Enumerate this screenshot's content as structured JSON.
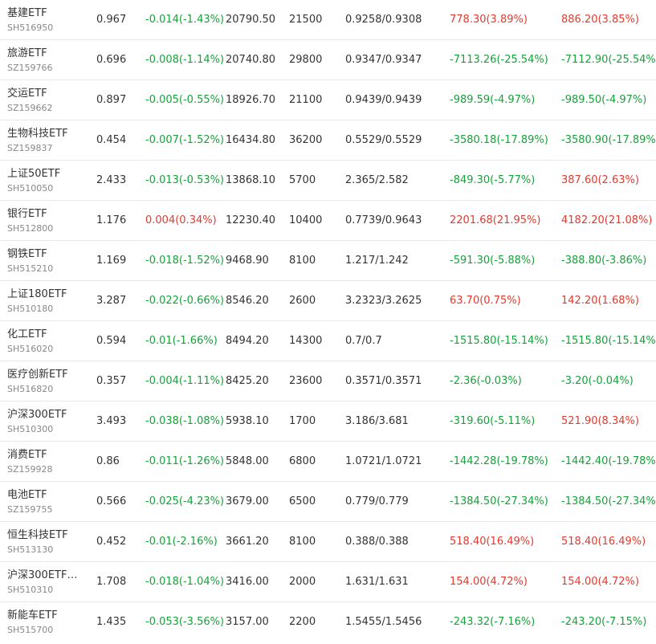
{
  "colors": {
    "up": "#e23a2e",
    "down": "#18a03b",
    "text": "#333333",
    "subtext": "#888888",
    "divider": "#e8e8e8"
  },
  "rows": [
    {
      "name": "基建ETF",
      "code": "SH516950",
      "price": "0.967",
      "change": "-0.014(-1.43%)",
      "change_dir": "down",
      "value": "20790.50",
      "shares": "21500",
      "cost": "0.9258/0.9308",
      "day_pl": "778.30(3.89%)",
      "day_pl_dir": "up",
      "total_pl": "886.20(3.85%)",
      "total_pl_dir": "up"
    },
    {
      "name": "旅游ETF",
      "code": "SZ159766",
      "price": "0.696",
      "change": "-0.008(-1.14%)",
      "change_dir": "down",
      "value": "20740.80",
      "shares": "29800",
      "cost": "0.9347/0.9347",
      "day_pl": "-7113.26(-25.54%)",
      "day_pl_dir": "down",
      "total_pl": "-7112.90(-25.54%)",
      "total_pl_dir": "down"
    },
    {
      "name": "交运ETF",
      "code": "SZ159662",
      "price": "0.897",
      "change": "-0.005(-0.55%)",
      "change_dir": "down",
      "value": "18926.70",
      "shares": "21100",
      "cost": "0.9439/0.9439",
      "day_pl": "-989.59(-4.97%)",
      "day_pl_dir": "down",
      "total_pl": "-989.50(-4.97%)",
      "total_pl_dir": "down"
    },
    {
      "name": "生物科技ETF",
      "code": "SZ159837",
      "price": "0.454",
      "change": "-0.007(-1.52%)",
      "change_dir": "down",
      "value": "16434.80",
      "shares": "36200",
      "cost": "0.5529/0.5529",
      "day_pl": "-3580.18(-17.89%)",
      "day_pl_dir": "down",
      "total_pl": "-3580.90(-17.89%)",
      "total_pl_dir": "down"
    },
    {
      "name": "上证50ETF",
      "code": "SH510050",
      "price": "2.433",
      "change": "-0.013(-0.53%)",
      "change_dir": "down",
      "value": "13868.10",
      "shares": "5700",
      "cost": "2.365/2.582",
      "day_pl": "-849.30(-5.77%)",
      "day_pl_dir": "down",
      "total_pl": "387.60(2.63%)",
      "total_pl_dir": "up"
    },
    {
      "name": "银行ETF",
      "code": "SH512800",
      "price": "1.176",
      "change": "0.004(0.34%)",
      "change_dir": "up",
      "value": "12230.40",
      "shares": "10400",
      "cost": "0.7739/0.9643",
      "day_pl": "2201.68(21.95%)",
      "day_pl_dir": "up",
      "total_pl": "4182.20(21.08%)",
      "total_pl_dir": "up"
    },
    {
      "name": "钢铁ETF",
      "code": "SH515210",
      "price": "1.169",
      "change": "-0.018(-1.52%)",
      "change_dir": "down",
      "value": "9468.90",
      "shares": "8100",
      "cost": "1.217/1.242",
      "day_pl": "-591.30(-5.88%)",
      "day_pl_dir": "down",
      "total_pl": "-388.80(-3.86%)",
      "total_pl_dir": "down"
    },
    {
      "name": "上证180ETF",
      "code": "SH510180",
      "price": "3.287",
      "change": "-0.022(-0.66%)",
      "change_dir": "down",
      "value": "8546.20",
      "shares": "2600",
      "cost": "3.2323/3.2625",
      "day_pl": "63.70(0.75%)",
      "day_pl_dir": "up",
      "total_pl": "142.20(1.68%)",
      "total_pl_dir": "up"
    },
    {
      "name": "化工ETF",
      "code": "SH516020",
      "price": "0.594",
      "change": "-0.01(-1.66%)",
      "change_dir": "down",
      "value": "8494.20",
      "shares": "14300",
      "cost": "0.7/0.7",
      "day_pl": "-1515.80(-15.14%)",
      "day_pl_dir": "down",
      "total_pl": "-1515.80(-15.14%)",
      "total_pl_dir": "down"
    },
    {
      "name": "医疗创新ETF",
      "code": "SH516820",
      "price": "0.357",
      "change": "-0.004(-1.11%)",
      "change_dir": "down",
      "value": "8425.20",
      "shares": "23600",
      "cost": "0.3571/0.3571",
      "day_pl": "-2.36(-0.03%)",
      "day_pl_dir": "down",
      "total_pl": "-3.20(-0.04%)",
      "total_pl_dir": "down"
    },
    {
      "name": "沪深300ETF",
      "code": "SH510300",
      "price": "3.493",
      "change": "-0.038(-1.08%)",
      "change_dir": "down",
      "value": "5938.10",
      "shares": "1700",
      "cost": "3.186/3.681",
      "day_pl": "-319.60(-5.11%)",
      "day_pl_dir": "down",
      "total_pl": "521.90(8.34%)",
      "total_pl_dir": "up"
    },
    {
      "name": "消费ETF",
      "code": "SZ159928",
      "price": "0.86",
      "change": "-0.011(-1.26%)",
      "change_dir": "down",
      "value": "5848.00",
      "shares": "6800",
      "cost": "1.0721/1.0721",
      "day_pl": "-1442.28(-19.78%)",
      "day_pl_dir": "down",
      "total_pl": "-1442.40(-19.78%)",
      "total_pl_dir": "down"
    },
    {
      "name": "电池ETF",
      "code": "SZ159755",
      "price": "0.566",
      "change": "-0.025(-4.23%)",
      "change_dir": "down",
      "value": "3679.00",
      "shares": "6500",
      "cost": "0.779/0.779",
      "day_pl": "-1384.50(-27.34%)",
      "day_pl_dir": "down",
      "total_pl": "-1384.50(-27.34%)",
      "total_pl_dir": "down"
    },
    {
      "name": "恒生科技ETF",
      "code": "SH513130",
      "price": "0.452",
      "change": "-0.01(-2.16%)",
      "change_dir": "down",
      "value": "3661.20",
      "shares": "8100",
      "cost": "0.388/0.388",
      "day_pl": "518.40(16.49%)",
      "day_pl_dir": "up",
      "total_pl": "518.40(16.49%)",
      "total_pl_dir": "up"
    },
    {
      "name": "沪深300ETF…",
      "code": "SH510310",
      "price": "1.708",
      "change": "-0.018(-1.04%)",
      "change_dir": "down",
      "value": "3416.00",
      "shares": "2000",
      "cost": "1.631/1.631",
      "day_pl": "154.00(4.72%)",
      "day_pl_dir": "up",
      "total_pl": "154.00(4.72%)",
      "total_pl_dir": "up"
    },
    {
      "name": "新能车ETF",
      "code": "SH515700",
      "price": "1.435",
      "change": "-0.053(-3.56%)",
      "change_dir": "down",
      "value": "3157.00",
      "shares": "2200",
      "cost": "1.5455/1.5456",
      "day_pl": "-243.32(-7.16%)",
      "day_pl_dir": "down",
      "total_pl": "-243.20(-7.15%)",
      "total_pl_dir": "down"
    }
  ]
}
